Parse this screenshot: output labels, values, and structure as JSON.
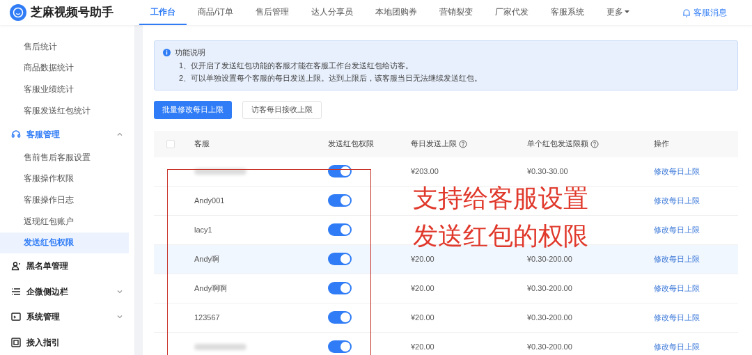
{
  "app": {
    "name": "芝麻视频号助手"
  },
  "nav": [
    {
      "label": "工作台",
      "selected": true
    },
    {
      "label": "商品/订单",
      "selected": false
    },
    {
      "label": "售后管理",
      "selected": false
    },
    {
      "label": "达人分享员",
      "selected": false
    },
    {
      "label": "本地团购券",
      "selected": false
    },
    {
      "label": "营销裂变",
      "selected": false
    },
    {
      "label": "厂家代发",
      "selected": false
    },
    {
      "label": "客服系统",
      "selected": false
    },
    {
      "label": "更多",
      "selected": false,
      "kind": "dropdown"
    }
  ],
  "messages_link": "客服消息",
  "sidebar": {
    "items": [
      {
        "label": "售后统计",
        "kind": "sub",
        "selected": false
      },
      {
        "label": "商品数据统计",
        "kind": "sub",
        "selected": false
      },
      {
        "label": "客服业绩统计",
        "kind": "sub",
        "selected": false
      },
      {
        "label": "客服发送红包统计",
        "kind": "sub",
        "selected": false
      },
      {
        "label": "客服管理",
        "kind": "group",
        "expanded": true,
        "active": true
      },
      {
        "label": "售前售后客服设置",
        "kind": "sub",
        "selected": false
      },
      {
        "label": "客服操作权限",
        "kind": "sub",
        "selected": false
      },
      {
        "label": "客服操作日志",
        "kind": "sub",
        "selected": false
      },
      {
        "label": "返现红包账户",
        "kind": "sub",
        "selected": false
      },
      {
        "label": "发送红包权限",
        "kind": "sub",
        "selected": true
      },
      {
        "label": "黑名单管理",
        "kind": "group",
        "active": false
      },
      {
        "label": "企微侧边栏",
        "kind": "group",
        "expanded": false,
        "active": false
      },
      {
        "label": "系统管理",
        "kind": "group",
        "expanded": false,
        "active": false
      },
      {
        "label": "接入指引",
        "kind": "group",
        "active": false
      }
    ]
  },
  "notice": {
    "title": "功能说明",
    "lines": [
      "1、仅开启了发送红包功能的客服才能在客服工作台发送红包给访客。",
      "2、可以单独设置每个客服的每日发送上限。达到上限后，该客服当日无法继续发送红包。"
    ]
  },
  "buttons": [
    {
      "label": "批量修改每日上限",
      "kind": "primary"
    },
    {
      "label": "访客每日接收上限",
      "kind": "default"
    }
  ],
  "table": {
    "header_checkbox": {
      "checked": false
    },
    "columns": [
      {
        "label": "客服"
      },
      {
        "label": "发送红包权限"
      },
      {
        "label": "每日发送上限",
        "help": true
      },
      {
        "label": "单个红包发送限额",
        "help": true
      },
      {
        "label": "操作"
      }
    ],
    "rows": [
      {
        "kind": "redacted",
        "on": true,
        "daily": "¥203.00",
        "range": "¥0.30-30.00",
        "action": "修改每日上限",
        "hovered": false
      },
      {
        "name": "Andy001",
        "kind": "text",
        "on": true,
        "action": "修改每日上限",
        "hovered": false
      },
      {
        "name": "lacy1",
        "kind": "text",
        "on": true,
        "action": "修改每日上限",
        "hovered": false
      },
      {
        "name": "Andy啊",
        "kind": "text",
        "on": true,
        "daily": "¥20.00",
        "range": "¥0.30-200.00",
        "action": "修改每日上限",
        "hovered": true
      },
      {
        "name": "Andy啊啊",
        "kind": "text",
        "on": true,
        "daily": "¥20.00",
        "range": "¥0.30-200.00",
        "action": "修改每日上限",
        "hovered": false
      },
      {
        "name": "123567",
        "kind": "text",
        "on": true,
        "daily": "¥20.00",
        "range": "¥0.30-200.00",
        "action": "修改每日上限",
        "hovered": false
      },
      {
        "kind": "redacted",
        "on": true,
        "daily": "¥20.00",
        "range": "¥0.30-200.00",
        "action": "修改每日上限",
        "hovered": false
      }
    ]
  },
  "annotation": {
    "lines": [
      "支持给客服设置",
      "发送红包的权限"
    ]
  }
}
